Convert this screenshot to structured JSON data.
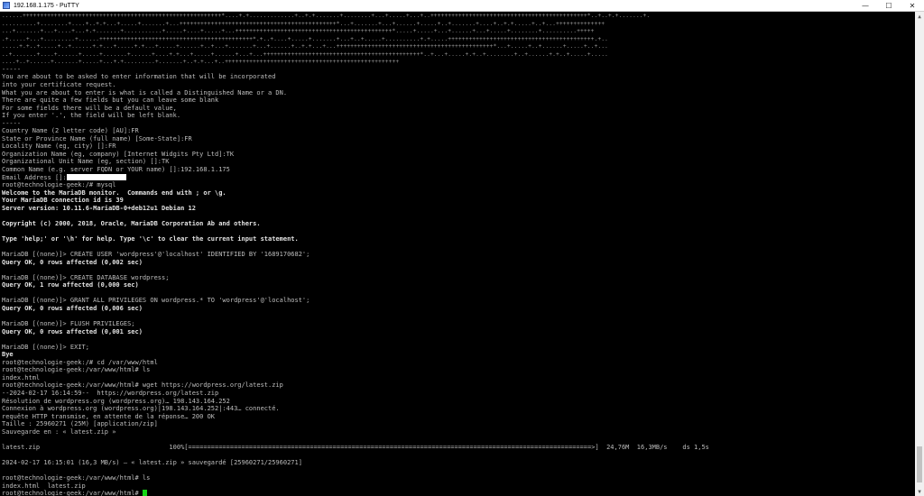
{
  "window": {
    "title": "192.168.1.175 - PuTTY",
    "minimize_glyph": "—",
    "maximize_glyph": "☐",
    "close_glyph": "✕",
    "icon": "putty-icon"
  },
  "terminal": {
    "fg": "#bdbdbd",
    "bg": "#000000",
    "cursor_color": "#14d414",
    "lines": [
      {
        "text": "......+++++++++++++++++++++++++++++++++++++++++++++++++++++++++*....+.+.............+..+.+.......+........+...+.....+...+..+++++++++++++++++++++++++++++++++++++++++++++*..+..+.+.......+.",
        "style": "dots"
      },
      {
        "text": "..........+........+....+..+.+...+.....+.......+...+++++++++++++++++++++++++++++++++++++++++++++*...+.......+...+......+.....+..+.......+....+..+.+.....+..+...++++++++++++++",
        "style": "dots"
      },
      {
        "text": "...+.......+...+....+...+.+.......+...........+.....+....+.....+...+++++++++++++++++++++++++++++++++++++++++++++*.....+.....+...+......+...+.....+........+..........+++++",
        "style": "dots"
      },
      {
        "text": ".+.....+...+.........+......++++++++++++++++++++++++++++++++++++++++++++*.+..+....+.....+.......+...+..+.....+..........+.+.....++++++++++++++++++++++++++++++++++++++++++.+..",
        "style": "dots"
      },
      {
        "text": ".....+.+..+.....+..+......+.+...+.....+.+...+.....+......+..+...+.......+...+......+..+.+...+...+++++++++++++++++++++++++++++++++++++++++++++*...+.....+..+......+.....+..+...",
        "style": "dots"
      },
      {
        "text": "..+.......+....+......+.....+.......+......+....+.+...+.....+......+...+...+++++++++++++++++++++++++++++++++++++++++++++*..+...+.....+.+..+........+..+......+.+..+.....+.....",
        "style": "dots"
      },
      {
        "text": "....+..+......+.......+.....+...+.+.........+.......+..+.+...+..++++++++++++++++++++++++++++++++++++++++++++++++++",
        "style": "dots"
      },
      {
        "text": "-----",
        "style": "normal"
      },
      {
        "text": "You are about to be asked to enter information that will be incorporated",
        "style": "normal"
      },
      {
        "text": "into your certificate request.",
        "style": "normal"
      },
      {
        "text": "What you are about to enter is what is called a Distinguished Name or a DN.",
        "style": "normal"
      },
      {
        "text": "There are quite a few fields but you can leave some blank",
        "style": "normal"
      },
      {
        "text": "For some fields there will be a default value,",
        "style": "normal"
      },
      {
        "text": "If you enter '.', the field will be left blank.",
        "style": "normal"
      },
      {
        "text": "-----",
        "style": "normal"
      },
      {
        "text": "Country Name (2 letter code) [AU]:FR",
        "style": "normal"
      },
      {
        "text": "State or Province Name (full name) [Some-State]:FR",
        "style": "normal"
      },
      {
        "text": "Locality Name (eg, city) []:FR",
        "style": "normal"
      },
      {
        "text": "Organization Name (eg, company) [Internet Widgits Pty Ltd]:TK",
        "style": "normal"
      },
      {
        "text": "Organizational Unit Name (eg, section) []:TK",
        "style": "normal"
      },
      {
        "text": "Common Name (e.g. server FQDN or YOUR name) []:192.168.1.175",
        "style": "normal"
      },
      {
        "text": "Email Address []:",
        "style": "normal",
        "redacted": true
      },
      {
        "text": "root@technologie-geek:/# mysql",
        "style": "normal"
      },
      {
        "text": "Welcome to the MariaDB monitor.  Commands end with ; or \\g.",
        "style": "bold"
      },
      {
        "text": "Your MariaDB connection id is 39",
        "style": "bold"
      },
      {
        "text": "Server version: 10.11.6-MariaDB-0+deb12u1 Debian 12",
        "style": "bold"
      },
      {
        "text": "",
        "style": "normal"
      },
      {
        "text": "Copyright (c) 2000, 2018, Oracle, MariaDB Corporation Ab and others.",
        "style": "bold"
      },
      {
        "text": "",
        "style": "normal"
      },
      {
        "text": "Type 'help;' or '\\h' for help. Type '\\c' to clear the current input statement.",
        "style": "bold"
      },
      {
        "text": "",
        "style": "normal"
      },
      {
        "text": "MariaDB [(none)]> CREATE USER 'wordpress'@'localhost' IDENTIFIED BY '1689170682';",
        "style": "normal"
      },
      {
        "text": "Query OK, 0 rows affected (0,002 sec)",
        "style": "bold"
      },
      {
        "text": "",
        "style": "normal"
      },
      {
        "text": "MariaDB [(none)]> CREATE DATABASE wordpress;",
        "style": "normal"
      },
      {
        "text": "Query OK, 1 row affected (0,000 sec)",
        "style": "bold"
      },
      {
        "text": "",
        "style": "normal"
      },
      {
        "text": "MariaDB [(none)]> GRANT ALL PRIVILEGES ON wordpress.* TO 'wordpress'@'localhost';",
        "style": "normal"
      },
      {
        "text": "Query OK, 0 rows affected (0,006 sec)",
        "style": "bold"
      },
      {
        "text": "",
        "style": "normal"
      },
      {
        "text": "MariaDB [(none)]> FLUSH PRIVILEGES;",
        "style": "normal"
      },
      {
        "text": "Query OK, 0 rows affected (0,001 sec)",
        "style": "bold"
      },
      {
        "text": "",
        "style": "normal"
      },
      {
        "text": "MariaDB [(none)]> EXIT;",
        "style": "normal"
      },
      {
        "text": "Bye",
        "style": "bold"
      },
      {
        "text": "root@technologie-geek:/# cd /var/www/html",
        "style": "normal"
      },
      {
        "text": "root@technologie-geek:/var/www/html# ls",
        "style": "normal"
      },
      {
        "text": "index.html",
        "style": "normal"
      },
      {
        "text": "root@technologie-geek:/var/www/html# wget https://wordpress.org/latest.zip",
        "style": "normal"
      },
      {
        "text": "--2024-02-17 16:14:59--  https://wordpress.org/latest.zip",
        "style": "normal"
      },
      {
        "text": "Résolution de wordpress.org (wordpress.org)… 198.143.164.252",
        "style": "normal"
      },
      {
        "text": "Connexion à wordpress.org (wordpress.org)|198.143.164.252|:443… connecté.",
        "style": "normal"
      },
      {
        "text": "requête HTTP transmise, en attente de la réponse… 200 OK",
        "style": "normal"
      },
      {
        "text": "Taille : 25960271 (25M) [application/zip]",
        "style": "normal"
      },
      {
        "text": "Sauvegarde en : « latest.zip »",
        "style": "normal"
      },
      {
        "text": "",
        "style": "normal"
      },
      {
        "text": "latest.zip                                  100%[==========================================================================================================>]  24,76M  16,3MB/s    ds 1,5s",
        "style": "normal"
      },
      {
        "text": "",
        "style": "normal"
      },
      {
        "text": "2024-02-17 16:15:01 (16,3 MB/s) — « latest.zip » sauvegardé [25960271/25960271]",
        "style": "normal"
      },
      {
        "text": "",
        "style": "normal"
      },
      {
        "text": "root@technologie-geek:/var/www/html# ls",
        "style": "normal"
      },
      {
        "text": "index.html  latest.zip",
        "style": "normal"
      },
      {
        "text": "root@technologie-geek:/var/www/html# ",
        "style": "normal",
        "cursor": true
      }
    ]
  },
  "scrollbar": {
    "up_arrow": "▲",
    "down_arrow": "▼"
  }
}
